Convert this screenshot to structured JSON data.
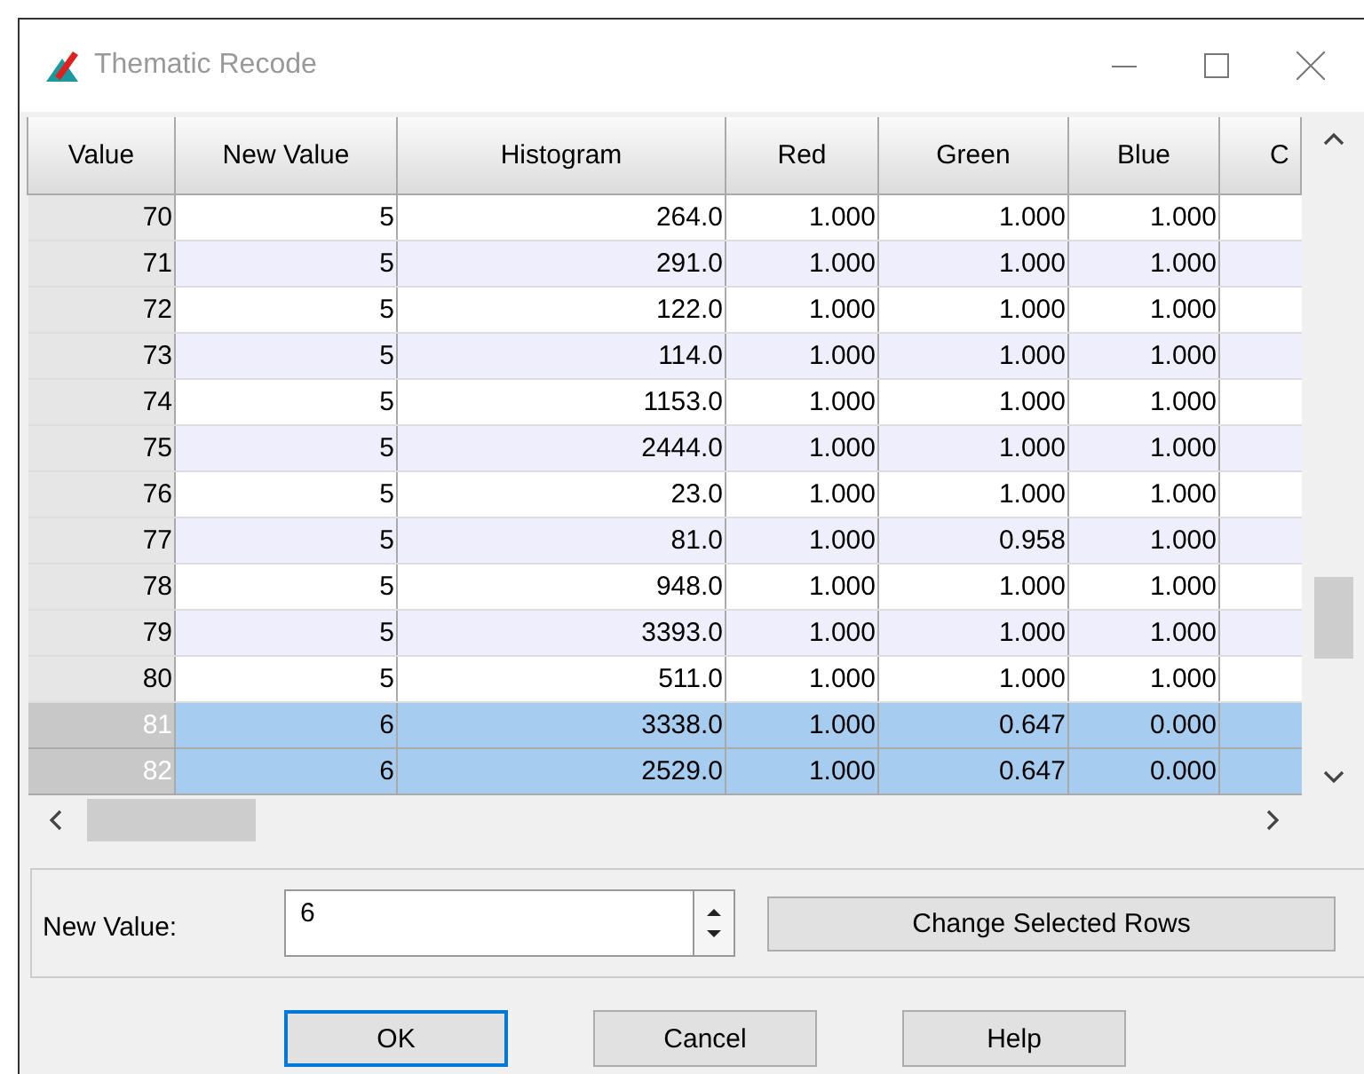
{
  "window": {
    "title": "Thematic Recode"
  },
  "table": {
    "columns": [
      "Value",
      "New Value",
      "Histogram",
      "Red",
      "Green",
      "Blue",
      "C"
    ],
    "rows": [
      {
        "cells": [
          "70",
          "5",
          "264.0",
          "1.000",
          "1.000",
          "1.000"
        ],
        "selected": false
      },
      {
        "cells": [
          "71",
          "5",
          "291.0",
          "1.000",
          "1.000",
          "1.000"
        ],
        "selected": false
      },
      {
        "cells": [
          "72",
          "5",
          "122.0",
          "1.000",
          "1.000",
          "1.000"
        ],
        "selected": false
      },
      {
        "cells": [
          "73",
          "5",
          "114.0",
          "1.000",
          "1.000",
          "1.000"
        ],
        "selected": false
      },
      {
        "cells": [
          "74",
          "5",
          "1153.0",
          "1.000",
          "1.000",
          "1.000"
        ],
        "selected": false
      },
      {
        "cells": [
          "75",
          "5",
          "2444.0",
          "1.000",
          "1.000",
          "1.000"
        ],
        "selected": false
      },
      {
        "cells": [
          "76",
          "5",
          "23.0",
          "1.000",
          "1.000",
          "1.000"
        ],
        "selected": false
      },
      {
        "cells": [
          "77",
          "5",
          "81.0",
          "1.000",
          "0.958",
          "1.000"
        ],
        "selected": false
      },
      {
        "cells": [
          "78",
          "5",
          "948.0",
          "1.000",
          "1.000",
          "1.000"
        ],
        "selected": false
      },
      {
        "cells": [
          "79",
          "5",
          "3393.0",
          "1.000",
          "1.000",
          "1.000"
        ],
        "selected": false
      },
      {
        "cells": [
          "80",
          "5",
          "511.0",
          "1.000",
          "1.000",
          "1.000"
        ],
        "selected": false
      },
      {
        "cells": [
          "81",
          "6",
          "3338.0",
          "1.000",
          "0.647",
          "0.000"
        ],
        "selected": true
      },
      {
        "cells": [
          "82",
          "6",
          "2529.0",
          "1.000",
          "0.647",
          "0.000"
        ],
        "selected": true
      }
    ]
  },
  "new_value": {
    "label": "New Value:",
    "value": "6"
  },
  "change_button": "Change Selected Rows",
  "buttons": [
    {
      "label": "OK",
      "focused": true
    },
    {
      "label": "Cancel",
      "focused": false
    },
    {
      "label": "Help",
      "focused": false
    }
  ]
}
